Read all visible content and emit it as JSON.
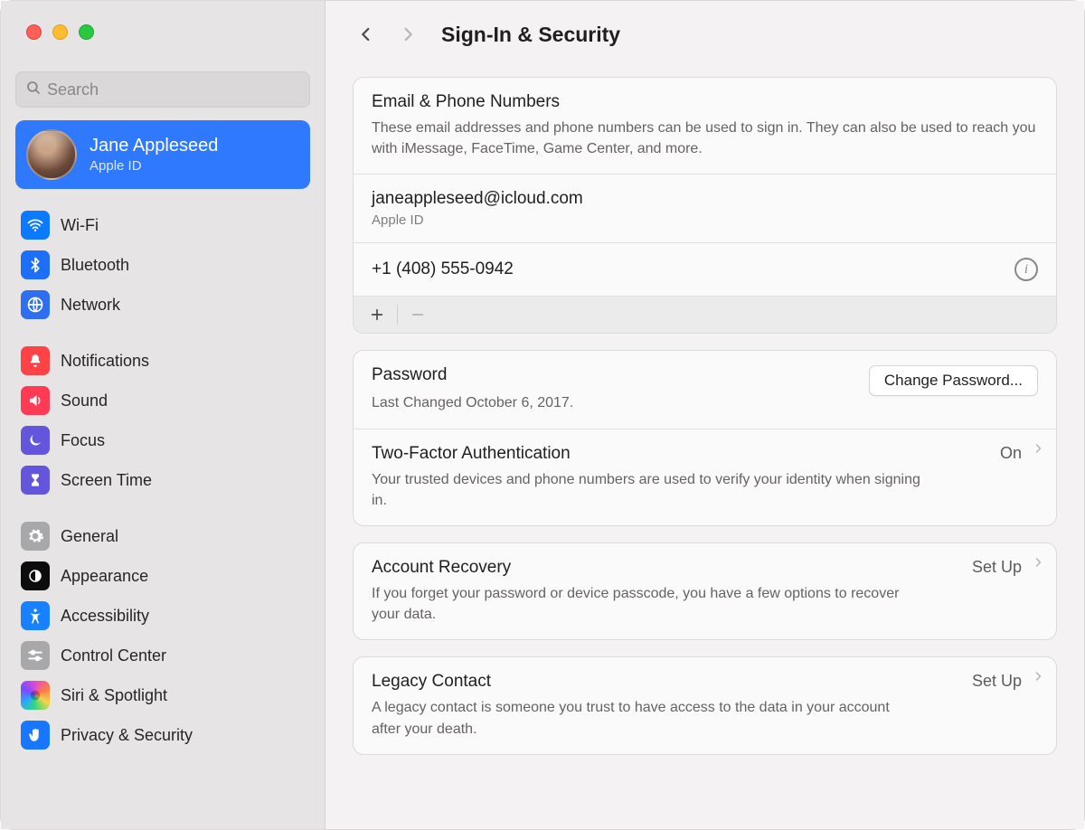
{
  "window": {
    "search_placeholder": "Search"
  },
  "profile": {
    "name": "Jane Appleseed",
    "subtitle": "Apple ID"
  },
  "sidebar": {
    "group1": [
      {
        "label": "Wi-Fi"
      },
      {
        "label": "Bluetooth"
      },
      {
        "label": "Network"
      }
    ],
    "group2": [
      {
        "label": "Notifications"
      },
      {
        "label": "Sound"
      },
      {
        "label": "Focus"
      },
      {
        "label": "Screen Time"
      }
    ],
    "group3": [
      {
        "label": "General"
      },
      {
        "label": "Appearance"
      },
      {
        "label": "Accessibility"
      },
      {
        "label": "Control Center"
      },
      {
        "label": "Siri & Spotlight"
      },
      {
        "label": "Privacy & Security"
      }
    ]
  },
  "header": {
    "title": "Sign-In & Security"
  },
  "email_section": {
    "title": "Email & Phone Numbers",
    "desc": "These email addresses and phone numbers can be used to sign in. They can also be used to reach you with iMessage, FaceTime, Game Center, and more.",
    "email": "janeappleseed@icloud.com",
    "email_label": "Apple ID",
    "phone": "+1 (408) 555-0942"
  },
  "password_section": {
    "title": "Password",
    "last_changed": "Last Changed October 6, 2017.",
    "button": "Change Password..."
  },
  "tfa_section": {
    "title": "Two-Factor Authentication",
    "status": "On",
    "desc": "Your trusted devices and phone numbers are used to verify your identity when signing in."
  },
  "recovery_section": {
    "title": "Account Recovery",
    "status": "Set Up",
    "desc": "If you forget your password or device passcode, you have a few options to recover your data."
  },
  "legacy_section": {
    "title": "Legacy Contact",
    "status": "Set Up",
    "desc": "A legacy contact is someone you trust to have access to the data in your account after your death."
  }
}
